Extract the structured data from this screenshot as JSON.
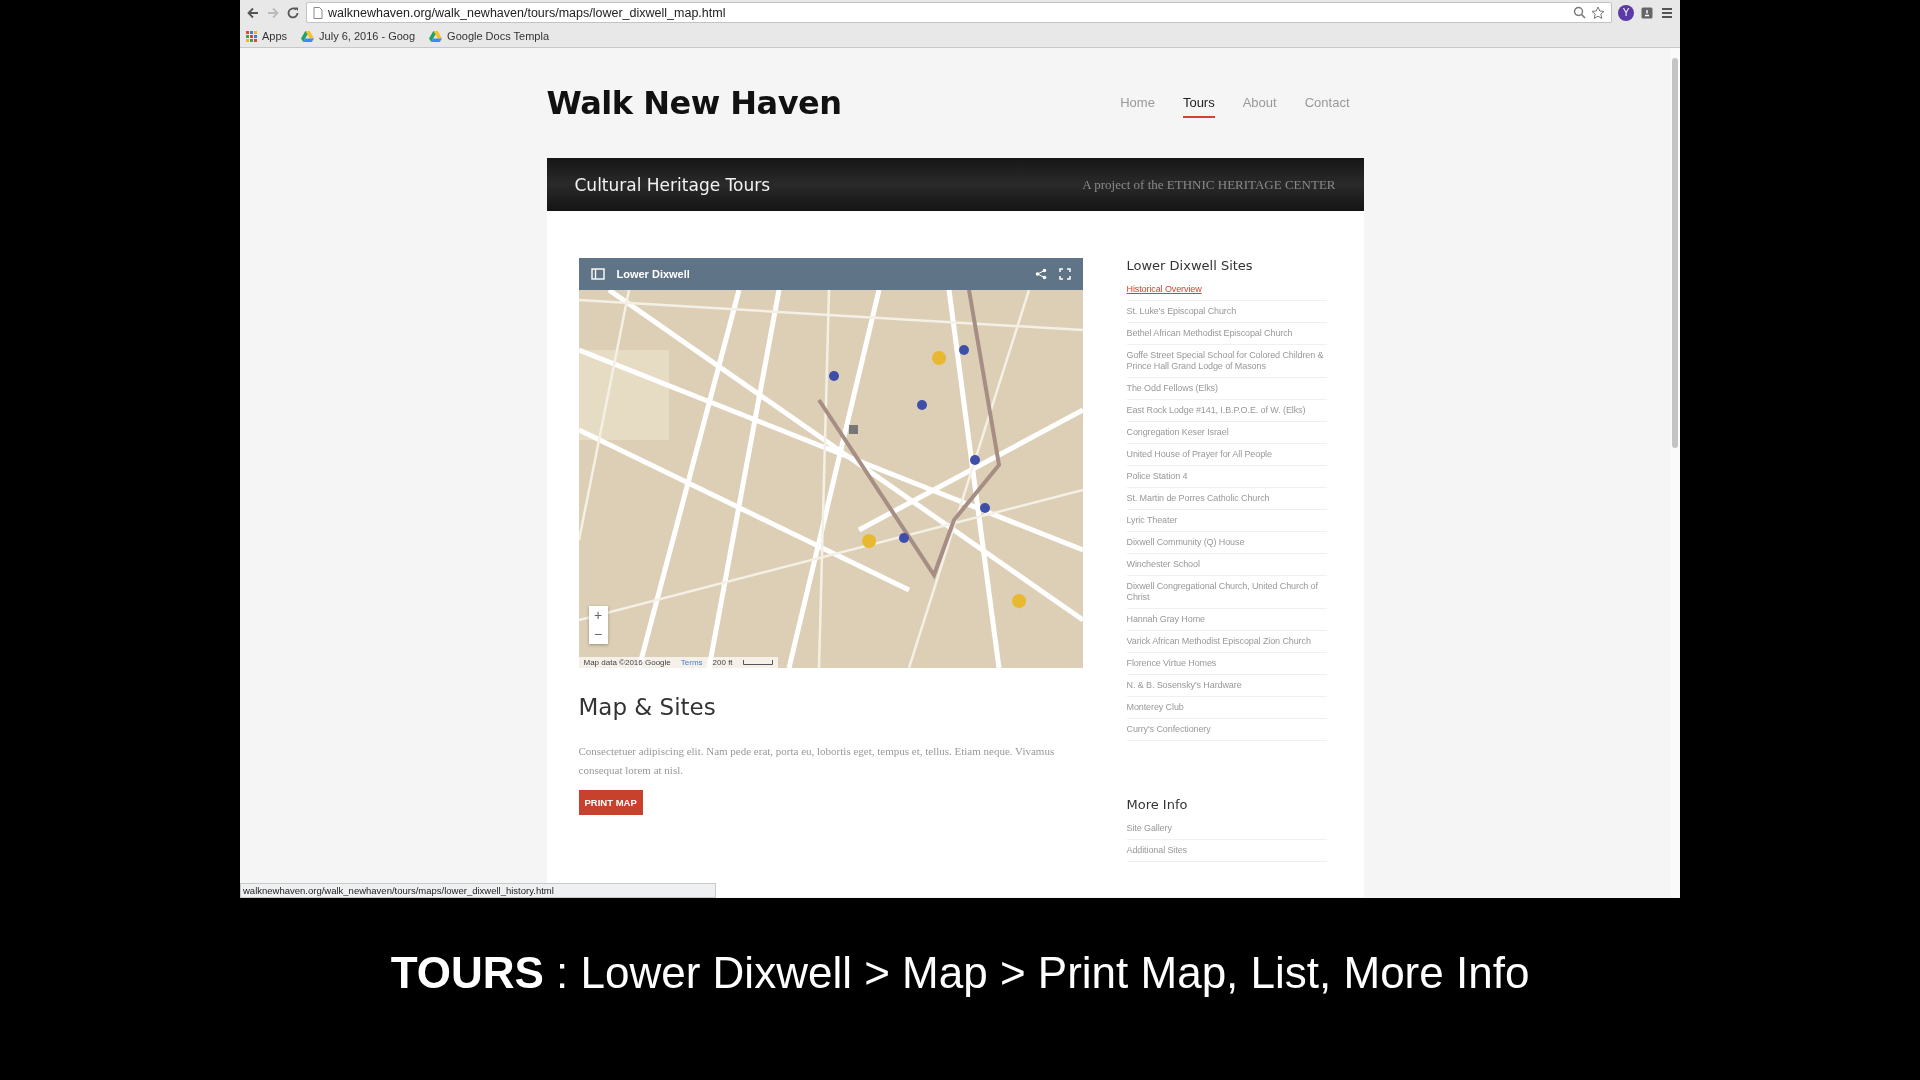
{
  "browser": {
    "url": "walknewhaven.org/walk_newhaven/tours/maps/lower_dixwell_map.html",
    "profile_initial": "Y",
    "bookmarks": [
      {
        "label": "Apps",
        "kind": "apps"
      },
      {
        "label": "July 6, 2016 - Goog",
        "kind": "drive"
      },
      {
        "label": "Google Docs Templa",
        "kind": "drive"
      }
    ],
    "status_url": "walknewhaven.org/walk_newhaven/tours/maps/lower_dixwell_history.html"
  },
  "site": {
    "title": "Walk New Haven",
    "nav": [
      {
        "label": "Home",
        "selected": false
      },
      {
        "label": "Tours",
        "selected": true
      },
      {
        "label": "About",
        "selected": false
      },
      {
        "label": "Contact",
        "selected": false
      }
    ],
    "banner": {
      "title": "Cultural Heritage Tours",
      "tagline": "A project of the ETHNIC HERITAGE CENTER"
    }
  },
  "map": {
    "title": "Lower Dixwell",
    "zoom_in": "+",
    "zoom_out": "−",
    "attribution": "Map data ©2016 Google",
    "terms": "Terms",
    "scale": "200 ft"
  },
  "section": {
    "heading": "Map & Sites",
    "text": "Consectetuer adipiscing elit. Nam pede erat, porta eu, lobortis eget, tempus et, tellus. Etiam neque. Vivamus consequat lorem at nisl.",
    "button": "PRINT MAP"
  },
  "sidebar": {
    "heading": "Lower Dixwell Sites",
    "items": [
      {
        "label": "Historical Overview",
        "selected": true
      },
      {
        "label": "St. Luke's Episcopal Church",
        "selected": false
      },
      {
        "label": "Bethel African Methodist Episcopal Church",
        "selected": false
      },
      {
        "label": "Goffe Street Special School for Colored Children & Prince Hall Grand Lodge of Masons",
        "selected": false
      },
      {
        "label": "The Odd Fellows (Elks)",
        "selected": false
      },
      {
        "label": "East Rock Lodge #141, I.B.P.O.E. of W. (Elks)",
        "selected": false
      },
      {
        "label": "Congregation Keser Israel",
        "selected": false
      },
      {
        "label": "United House of Prayer for All People",
        "selected": false
      },
      {
        "label": "Police Station 4",
        "selected": false
      },
      {
        "label": "St. Martin de Porres Catholic Church",
        "selected": false
      },
      {
        "label": "Lyric Theater",
        "selected": false
      },
      {
        "label": "Dixwell Community (Q) House",
        "selected": false
      },
      {
        "label": "Winchester School",
        "selected": false
      },
      {
        "label": "Dixwell Congregational Church, United Church of Christ",
        "selected": false
      },
      {
        "label": "Hannah Gray Home",
        "selected": false
      },
      {
        "label": "Varick African Methodist Episcopal Zion Church",
        "selected": false
      },
      {
        "label": "Florence Virtue Homes",
        "selected": false
      },
      {
        "label": "N. & B. Sosensky's Hardware",
        "selected": false
      },
      {
        "label": "Monterey Club",
        "selected": false
      },
      {
        "label": "Curry's Confectionery",
        "selected": false
      }
    ]
  },
  "more_info": {
    "heading": "More Info",
    "items": [
      "Site Gallery",
      "Additional Sites"
    ]
  },
  "caption": "**TOURS** : Lower Dixwell > Map > Print Map, List, More Info"
}
